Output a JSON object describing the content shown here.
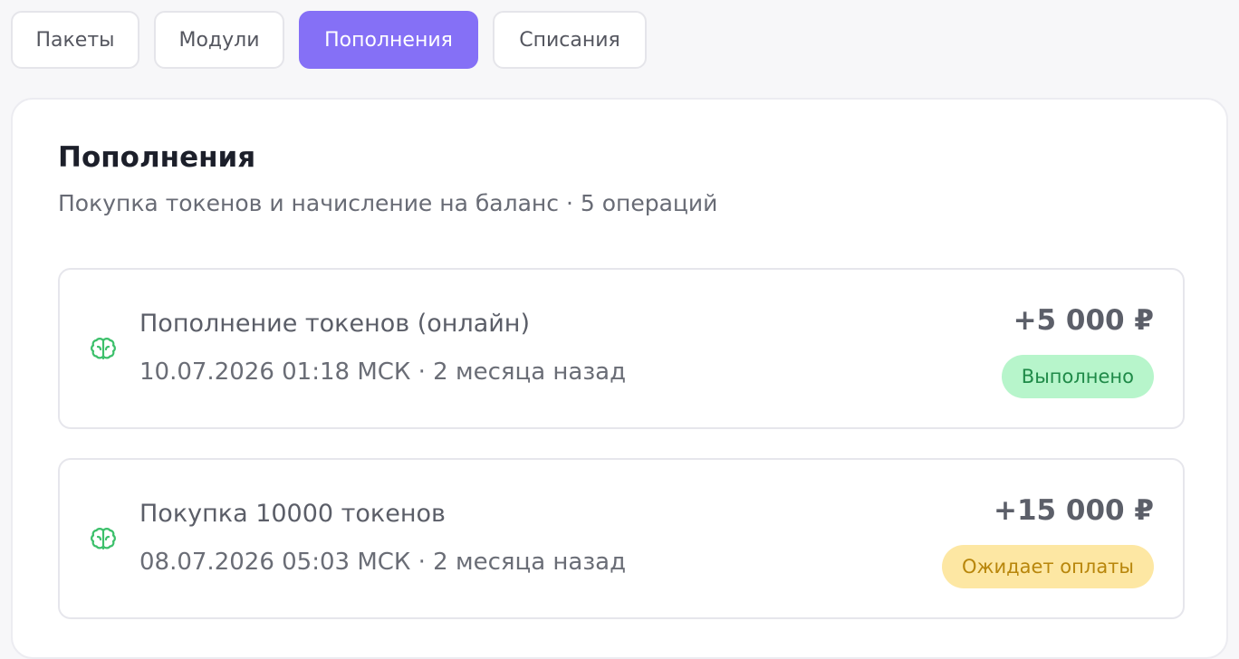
{
  "tabs": [
    {
      "label": "Пакеты",
      "active": false
    },
    {
      "label": "Модули",
      "active": false
    },
    {
      "label": "Пополнения",
      "active": true
    },
    {
      "label": "Списания",
      "active": false
    }
  ],
  "panel": {
    "title": "Пополнения",
    "subtitle": "Покупка токенов и начисление на баланс · 5 операций"
  },
  "operations": [
    {
      "icon": "brain-icon",
      "title": "Пополнение токенов (онлайн)",
      "meta": "10.07.2026 01:18 МСК · 2 месяца назад",
      "amount": "+5 000 ₽",
      "status": "Выполнено",
      "status_type": "done"
    },
    {
      "icon": "brain-icon",
      "title": "Покупка 10000 токенов",
      "meta": "08.07.2026 05:03 МСК · 2 месяца назад",
      "amount": "+15 000 ₽",
      "status": "Ожидает оплаты",
      "status_type": "pending"
    }
  ],
  "colors": {
    "accent": "#8570f6",
    "icon_green": "#3cc06b",
    "done_bg": "#b7f5cb",
    "done_text": "#1f8a48",
    "pending_bg": "#fde7a3",
    "pending_text": "#b8860b"
  }
}
